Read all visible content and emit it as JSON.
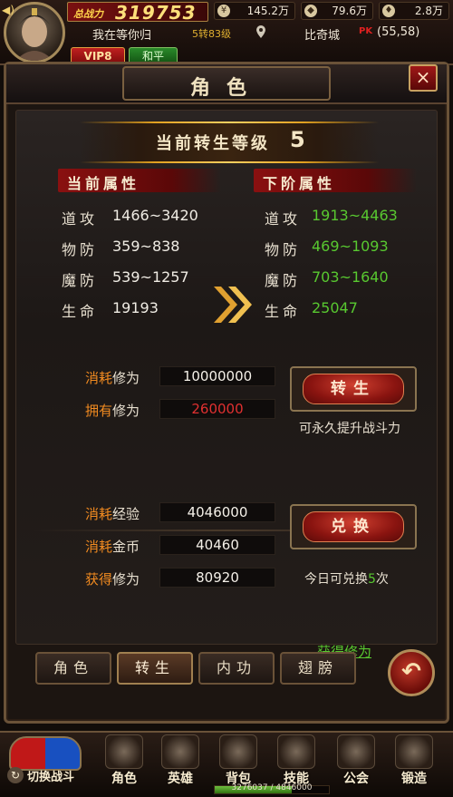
{
  "topbar": {
    "power_label": "总战力",
    "power_value": "319753",
    "resources": [
      {
        "icon": "coin-icon",
        "value": "145.2万"
      },
      {
        "icon": "ingot-icon",
        "value": "79.6万"
      },
      {
        "icon": "gem-icon",
        "value": "2.8万"
      }
    ],
    "player_name": "我在等你归",
    "player_level": "5转83级",
    "location": "比奇城",
    "pk_tag": "PK",
    "coords": "(55,58)",
    "vip_label": "VIP8",
    "peace_label": "和平"
  },
  "panel": {
    "title": "角色",
    "close": "×",
    "level_label": "当前转生等级",
    "level_value": "5",
    "current_header": "当前属性",
    "next_header": "下阶属性",
    "current_attrs": [
      {
        "key": "道攻",
        "value": "1466~3420"
      },
      {
        "key": "物防",
        "value": "359~838"
      },
      {
        "key": "魔防",
        "value": "539~1257"
      },
      {
        "key": "生命",
        "value": "19193"
      }
    ],
    "next_attrs": [
      {
        "key": "道攻",
        "value": "1913~4463"
      },
      {
        "key": "物防",
        "value": "469~1093"
      },
      {
        "key": "魔防",
        "value": "703~1640"
      },
      {
        "key": "生命",
        "value": "25047"
      }
    ],
    "rebirth": {
      "cost_prefix": "消耗",
      "cost_suffix": "修为",
      "cost_value": "10000000",
      "own_prefix": "拥有",
      "own_suffix": "修为",
      "own_value": "260000",
      "own_color": "#e03030",
      "button": "转生",
      "note": "可永久提升战斗力"
    },
    "exchange": {
      "exp_prefix": "消耗",
      "exp_suffix": "经验",
      "exp_value": "4046000",
      "gold_prefix": "消耗",
      "gold_suffix": "金币",
      "gold_value": "40460",
      "gain_prefix": "获得",
      "gain_suffix": "修为",
      "gain_value": "80920",
      "button": "兑换",
      "today_prefix": "今日可兑换",
      "today_count": "5",
      "today_suffix": "次",
      "link": "获得修为"
    },
    "tabs": [
      "角色",
      "转生",
      "内功",
      "翅膀"
    ],
    "active_tab": 1,
    "back_icon": "back-arrow-icon"
  },
  "bottombar": {
    "switch_label": "切换战斗",
    "nav": [
      "角色",
      "英雄",
      "背包",
      "技能",
      "公会",
      "锻造"
    ],
    "exp_text": "3276037 / 4846000",
    "exp_fraction": 0.676
  }
}
